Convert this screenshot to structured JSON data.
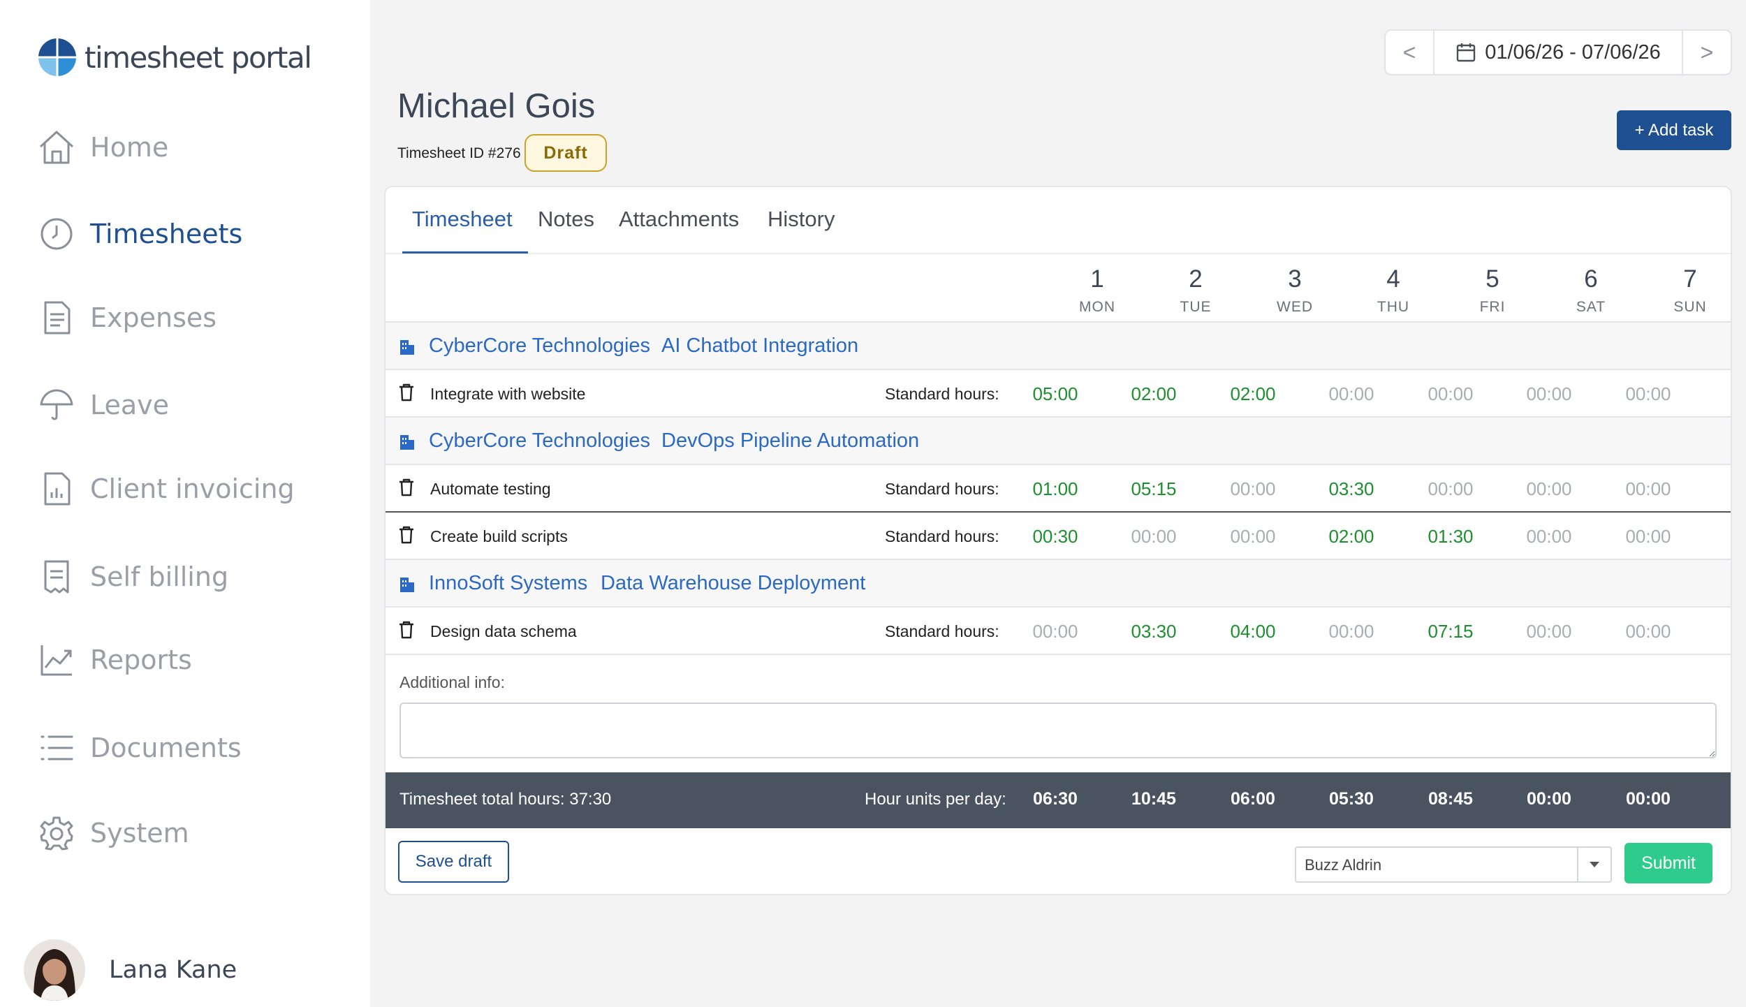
{
  "brand": {
    "name": "timesheet portal"
  },
  "sidebar": {
    "items": [
      {
        "label": "Home",
        "icon": "home-icon",
        "active": false
      },
      {
        "label": "Timesheets",
        "icon": "clock-icon",
        "active": true
      },
      {
        "label": "Expenses",
        "icon": "receipt-icon",
        "active": false
      },
      {
        "label": "Leave",
        "icon": "umbrella-icon",
        "active": false
      },
      {
        "label": "Client invoicing",
        "icon": "invoice-chart-icon",
        "active": false
      },
      {
        "label": "Self billing",
        "icon": "bill-icon",
        "active": false
      },
      {
        "label": "Reports",
        "icon": "trend-chart-icon",
        "active": false
      },
      {
        "label": "Documents",
        "icon": "list-icon",
        "active": false
      },
      {
        "label": "System",
        "icon": "gear-icon",
        "active": false
      }
    ],
    "user": {
      "name": "Lana Kane"
    }
  },
  "header": {
    "date_range": "01/06/26 - 07/06/26",
    "prev_glyph": "<",
    "next_glyph": ">",
    "employee_name": "Michael Gois",
    "timesheet_id": "Timesheet ID #276",
    "status": "Draft",
    "add_task_label": "+ Add task"
  },
  "tabs": [
    "Timesheet",
    "Notes",
    "Attachments",
    "History"
  ],
  "days": [
    {
      "num": "1",
      "dow": "MON"
    },
    {
      "num": "2",
      "dow": "TUE"
    },
    {
      "num": "3",
      "dow": "WED"
    },
    {
      "num": "4",
      "dow": "THU"
    },
    {
      "num": "5",
      "dow": "FRI"
    },
    {
      "num": "6",
      "dow": "SAT"
    },
    {
      "num": "7",
      "dow": "SUN"
    }
  ],
  "groups": [
    {
      "client": "CyberCore Technologies",
      "project": "AI Chatbot Integration",
      "tasks": [
        {
          "name": "Integrate with website",
          "rate": "Standard hours:",
          "hours": [
            "05:00",
            "02:00",
            "02:00",
            "00:00",
            "00:00",
            "00:00",
            "00:00"
          ]
        }
      ]
    },
    {
      "client": "CyberCore Technologies",
      "project": "DevOps Pipeline Automation",
      "tasks": [
        {
          "name": "Automate testing",
          "rate": "Standard hours:",
          "hours": [
            "01:00",
            "05:15",
            "00:00",
            "03:30",
            "00:00",
            "00:00",
            "00:00"
          ]
        },
        {
          "name": "Create build scripts",
          "rate": "Standard hours:",
          "hours": [
            "00:30",
            "00:00",
            "00:00",
            "02:00",
            "01:30",
            "00:00",
            "00:00"
          ]
        }
      ]
    },
    {
      "client": "InnoSoft Systems",
      "project": "Data Warehouse Deployment",
      "tasks": [
        {
          "name": "Design data schema",
          "rate": "Standard hours:",
          "hours": [
            "00:00",
            "03:30",
            "04:00",
            "00:00",
            "07:15",
            "00:00",
            "00:00"
          ]
        }
      ]
    }
  ],
  "additional_info": {
    "label": "Additional info:",
    "value": ""
  },
  "totals": {
    "label": "Timesheet total hours: 37:30",
    "units_label": "Hour units per day:",
    "per_day": [
      "06:30",
      "10:45",
      "06:00",
      "05:30",
      "08:45",
      "00:00",
      "00:00"
    ]
  },
  "footer": {
    "save_draft_label": "Save draft",
    "approver": "Buzz Aldrin",
    "submit_label": "Submit"
  },
  "colors": {
    "brand_blue": "#1d4f91",
    "link_blue": "#2b69c7",
    "hours_on": "#1e8f2e",
    "hours_off": "#a9adb3",
    "submit_green": "#2ecc8a",
    "totals_bar": "#4a5461"
  }
}
